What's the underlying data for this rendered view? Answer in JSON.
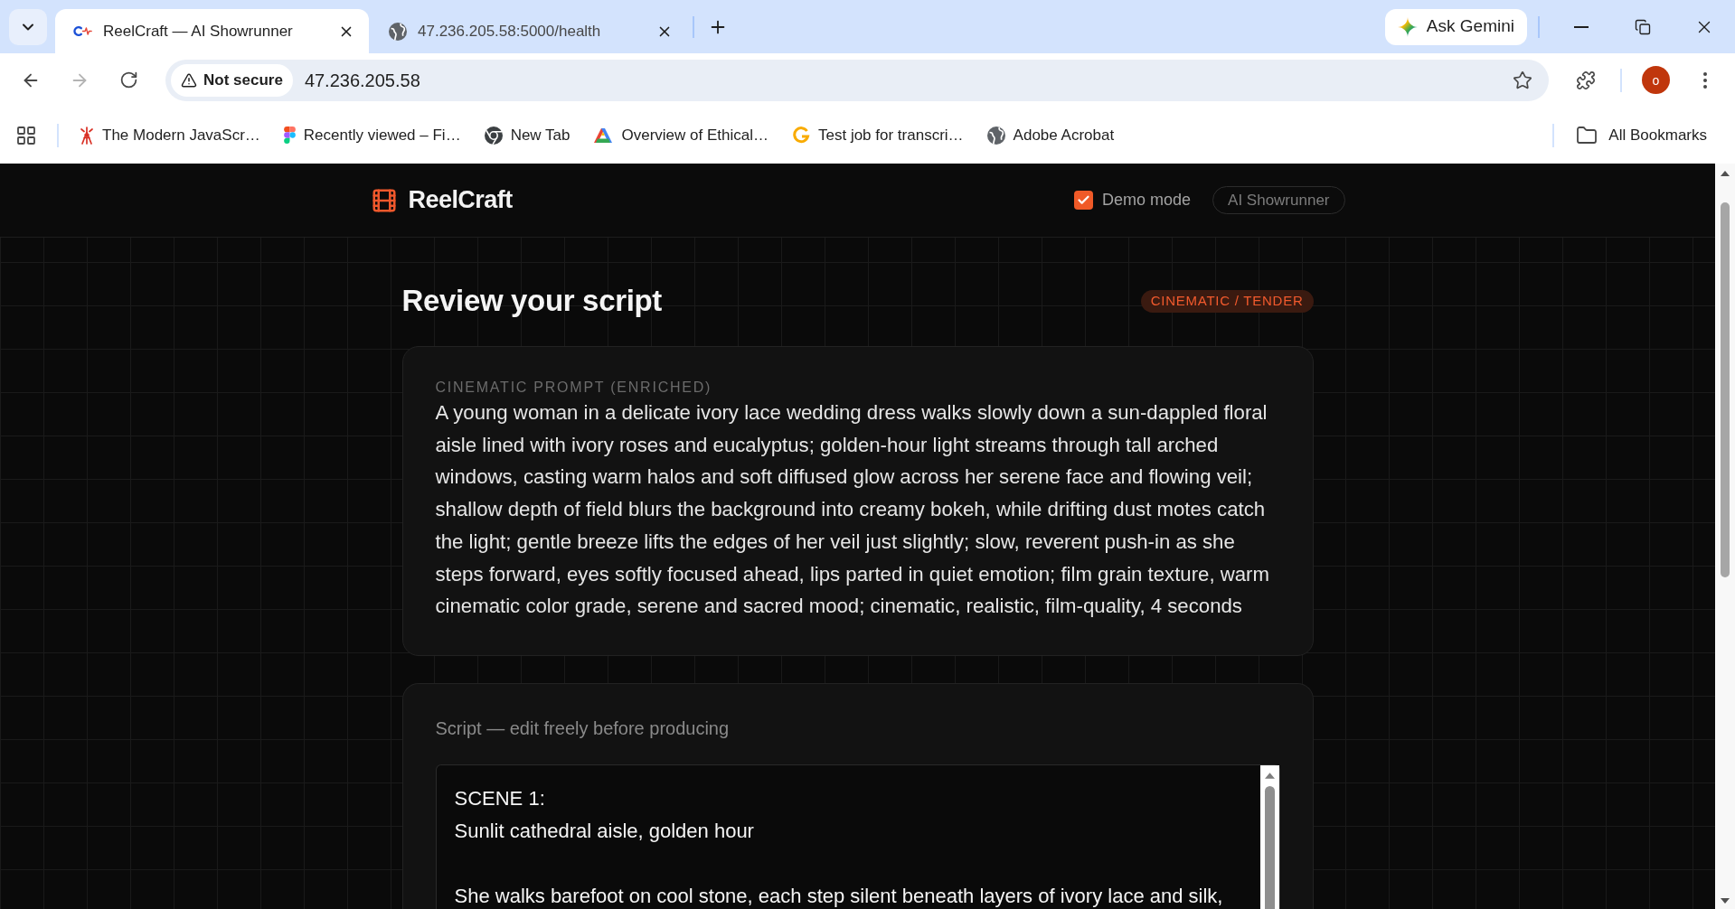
{
  "browser": {
    "tabs": [
      {
        "title": "ReelCraft — AI Showrunner",
        "kind": "logo",
        "selected": true
      },
      {
        "title": "47.236.205.58:5000/health",
        "kind": "globe",
        "selected": false
      }
    ],
    "gemini_button": "Ask Gemini",
    "nav_buttons": [
      {
        "kind": "back",
        "disabled": false
      },
      {
        "kind": "forward",
        "disabled": true
      },
      {
        "kind": "reload",
        "disabled": false
      }
    ],
    "security_chip": "Not secure",
    "url": "47.236.205.58",
    "profile_initial": "o",
    "bookmarks": [
      {
        "label": "The Modern JavaScr…",
        "kind": "tower"
      },
      {
        "label": "Recently viewed – Fi…",
        "kind": "blocks"
      },
      {
        "label": "New Tab",
        "kind": "browser"
      },
      {
        "label": "Overview of Ethical…",
        "kind": "triangle"
      },
      {
        "label": "Test job for transcri…",
        "kind": "letter"
      },
      {
        "label": "Adobe Acrobat",
        "kind": "globe"
      }
    ],
    "all_bookmarks": "All Bookmarks"
  },
  "app": {
    "brand": "ReelCraft",
    "demo_mode": {
      "label": "Demo mode",
      "checked": true
    },
    "mode_pill": "AI Showrunner",
    "title": "Review your script",
    "style_badge": "CINEMATIC / TENDER",
    "prompt": {
      "label": "CINEMATIC PROMPT (ENRICHED)",
      "text": "A young woman in a delicate ivory lace wedding dress walks slowly down a sun-dappled floral aisle lined with ivory roses and eucalyptus; golden-hour light streams through tall arched windows, casting warm halos and soft diffused glow across her serene face and flowing veil; shallow depth of field blurs the background into creamy bokeh, while drifting dust motes catch the light; gentle breeze lifts the edges of her veil just slightly; slow, reverent push-in as she steps forward, eyes softly focused ahead, lips parted in quiet emotion; film grain texture, warm cinematic color grade, serene and sacred mood; cinematic, realistic, film-quality, 4 seconds"
    },
    "script": {
      "label": "Script — edit freely before producing",
      "value": "SCENE 1:\nSunlit cathedral aisle, golden hour\n\nShe walks barefoot on cool stone, each step silent beneath layers of ivory lace and silk,"
    }
  }
}
